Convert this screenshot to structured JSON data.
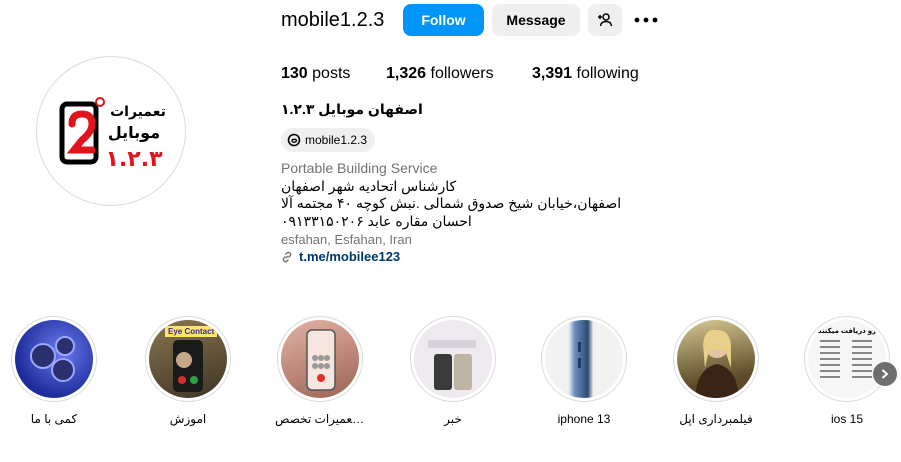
{
  "profile": {
    "username": "mobile1.2.3",
    "full_name": "اصفهان موبایل ۱.۲.۳",
    "logo_text_top": "تعمیرات",
    "logo_text_mid": "موبایل",
    "logo_text_num": "۱.۲.۳"
  },
  "header": {
    "follow_label": "Follow",
    "message_label": "Message"
  },
  "stats": {
    "posts": "130",
    "posts_label": "posts",
    "followers": "1,326",
    "followers_label": "followers",
    "following": "3,391",
    "following_label": "following"
  },
  "bio": {
    "threads_handle": "mobile1.2.3",
    "category": "Portable Building Service",
    "lines": [
      "کارشناس اتحادیه شهر اصفهان",
      "اصفهان،خیابان شیخ صدوق شمالی .نبش کوچه ۴۰ مجتمه آلا",
      "احسان مقاره عابد ۰۹۱۳۳۱۵۰۲۰۶"
    ],
    "location": "esfahan, Esfahan, Iran",
    "link": "t.me/mobilee123"
  },
  "highlights": [
    {
      "label": "کمی با ما",
      "color": "#2b3fb8"
    },
    {
      "label": "اموزش",
      "color": "#6a5a40",
      "overlay": "Eye Contact"
    },
    {
      "label": "تعمیرات تخصص...",
      "color": "#c98a7c"
    },
    {
      "label": "خبر",
      "color": "#e8e4ea"
    },
    {
      "label": "iphone 13",
      "color": "#5d7fa6"
    },
    {
      "label": "فیلمبرداری اپل",
      "color": "#7a6a42"
    },
    {
      "label": "ios 15",
      "color": "#f4f4f4",
      "overlay": "رو دریافت میکنند"
    }
  ],
  "colors": {
    "accent": "#0095f6",
    "link": "#00376b",
    "secondary_text": "#737373",
    "button_gray": "#efefef",
    "logo_red": "#e3131c"
  }
}
